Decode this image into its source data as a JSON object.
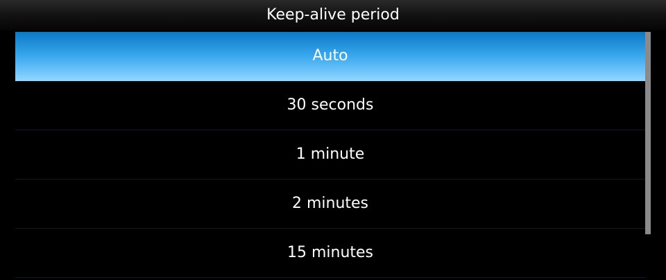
{
  "dialog": {
    "title": "Keep-alive period"
  },
  "options": [
    {
      "label": "Auto",
      "selected": true
    },
    {
      "label": "30 seconds",
      "selected": false
    },
    {
      "label": "1 minute",
      "selected": false
    },
    {
      "label": "2 minutes",
      "selected": false
    },
    {
      "label": "15 minutes",
      "selected": false
    }
  ],
  "colors": {
    "selection_top": "#0b78c6",
    "selection_bottom": "#8fd6ff",
    "background": "#000000",
    "scrollbar": "#8a8a8a"
  }
}
